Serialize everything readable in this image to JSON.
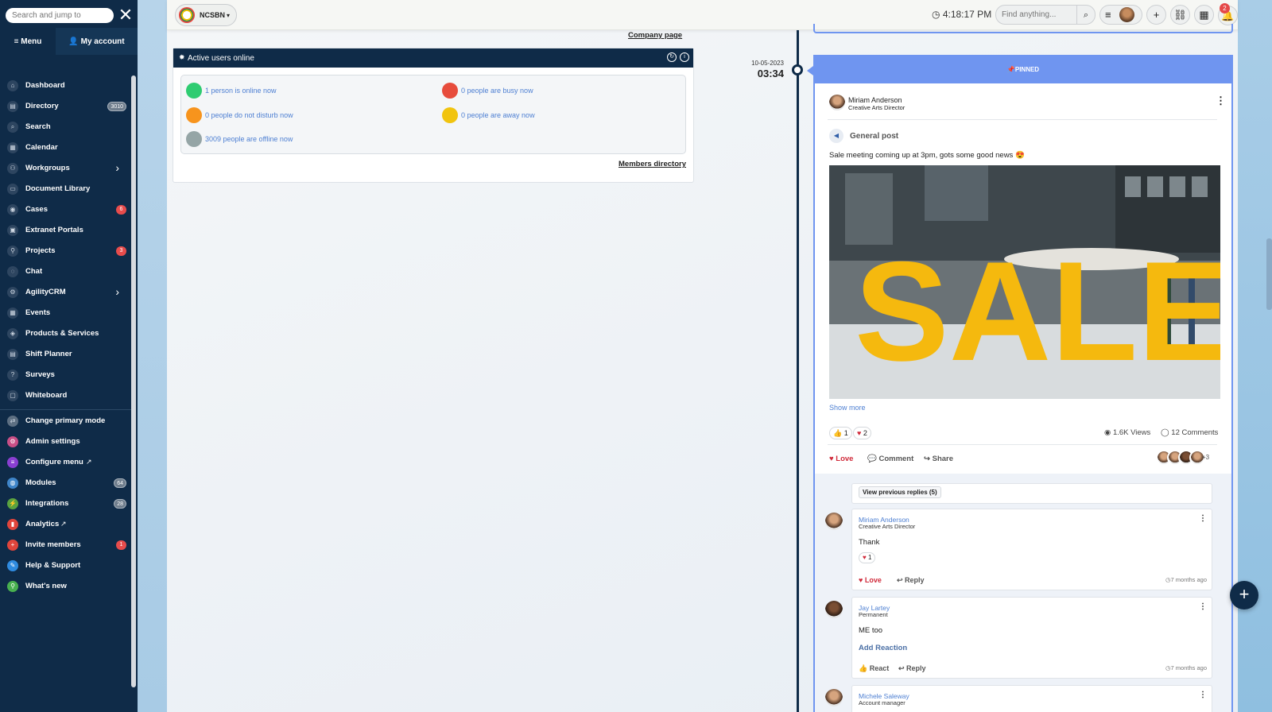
{
  "sidebar": {
    "search_placeholder": "Search and jump to",
    "tab_menu": "Menu",
    "tab_account": "My account",
    "items": [
      {
        "label": "Dashboard",
        "icon": "home-icon"
      },
      {
        "label": "Directory",
        "icon": "directory-icon",
        "badge": "3010"
      },
      {
        "label": "Search",
        "icon": "search-icon"
      },
      {
        "label": "Calendar",
        "icon": "calendar-icon"
      },
      {
        "label": "Workgroups",
        "icon": "users-icon",
        "chevron": true
      },
      {
        "label": "Document Library",
        "icon": "folder-icon"
      },
      {
        "label": "Cases",
        "icon": "cases-icon",
        "badge": "6"
      },
      {
        "label": "Extranet Portals",
        "icon": "portal-icon"
      },
      {
        "label": "Projects",
        "icon": "projects-icon",
        "badge": "3"
      },
      {
        "label": "Chat",
        "icon": "chat-icon"
      },
      {
        "label": "AgilityCRM",
        "icon": "crm-icon",
        "chevron": true
      },
      {
        "label": "Events",
        "icon": "events-icon"
      },
      {
        "label": "Products & Services",
        "icon": "products-icon"
      },
      {
        "label": "Shift Planner",
        "icon": "shift-icon"
      },
      {
        "label": "Surveys",
        "icon": "surveys-icon"
      },
      {
        "label": "Whiteboard",
        "icon": "whiteboard-icon"
      }
    ],
    "admin_items": [
      {
        "label": "Change primary mode",
        "icon": "swap-icon",
        "color": "#5d6f82"
      },
      {
        "label": "Admin settings",
        "icon": "settings-icon",
        "color": "#c94f86"
      },
      {
        "label": "Configure menu",
        "icon": "menu-icon",
        "color": "#8a3fd1",
        "ext": true
      },
      {
        "label": "Modules",
        "icon": "modules-icon",
        "color": "#3f85c9",
        "badge": "64"
      },
      {
        "label": "Integrations",
        "icon": "integrations-icon",
        "color": "#5aa340",
        "badge": "28"
      },
      {
        "label": "Analytics",
        "icon": "analytics-icon",
        "color": "#e0453c",
        "ext": true
      },
      {
        "label": "Invite members",
        "icon": "invite-icon",
        "color": "#e0453c",
        "badge": "1"
      },
      {
        "label": "Help & Support",
        "icon": "help-icon",
        "color": "#2f8be0"
      },
      {
        "label": "What's new",
        "icon": "whats-new-icon",
        "color": "#48b04f"
      }
    ]
  },
  "topbar": {
    "org_name": "NCSBN",
    "time": "4:18:17 PM",
    "find_placeholder": "Find anything...",
    "notification_count": "2"
  },
  "company_link": "Company page",
  "active_users": {
    "title": "Active users online",
    "stats": [
      {
        "text": "1 person is online now",
        "color": "#2ecc71"
      },
      {
        "text": "0 people are busy now",
        "color": "#e74c3c"
      },
      {
        "text": "0 people do not disturb now",
        "color": "#f7941d"
      },
      {
        "text": "0 people are away now",
        "color": "#f1c40f"
      },
      {
        "text": "3009 people are offline now",
        "color": "#95a5a6"
      }
    ],
    "members_link": "Members directory"
  },
  "timeline": {
    "date": "10-05-2023",
    "time": "03:34"
  },
  "post": {
    "pinned_label": "PINNED",
    "author": "Miriam Anderson",
    "author_role": "Creative Arts Director",
    "type_label": "General post",
    "text": "Sale meeting coming up at 3pm, gots some good news 😍",
    "image_word": "SALE",
    "show_more": "Show more",
    "like_count": "1",
    "love_count": "2",
    "views": "1.6K Views",
    "comments": "12 Comments",
    "action_love": "Love",
    "action_comment": "Comment",
    "action_share": "Share",
    "more_avatars": "+3",
    "view_previous": "View previous replies (5)",
    "replies": [
      {
        "name": "Miriam Anderson",
        "role": "Creative Arts Director",
        "text": "Thank",
        "reaction_count": "1",
        "action1": "Love",
        "action2": "Reply",
        "time": "7 months ago"
      },
      {
        "name": "Jay Lartey",
        "role": "Permanent",
        "text": "ME too",
        "add_reaction": "Add Reaction",
        "action1": "React",
        "action2": "Reply",
        "time": "7 months ago"
      },
      {
        "name": "Michele Saleway",
        "role": "Account manager"
      }
    ]
  }
}
